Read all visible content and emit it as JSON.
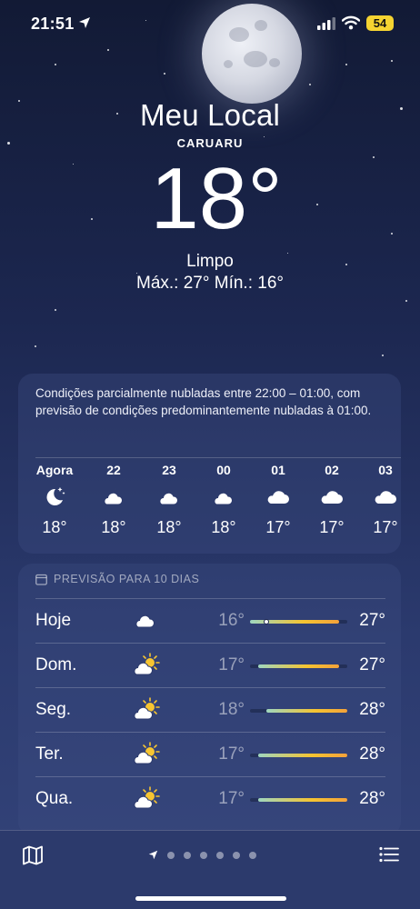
{
  "status_bar": {
    "time": "21:51",
    "battery": "54",
    "icons": [
      "location-arrow-icon",
      "cellular-signal-icon",
      "wifi-icon",
      "battery-icon"
    ]
  },
  "header": {
    "title": "Meu Local",
    "city": "CARUARU",
    "temperature": "18°",
    "condition": "Limpo",
    "hi_lo": "Máx.: 27°  Mín.: 16°"
  },
  "hourly": {
    "summary": "Condições parcialmente nubladas entre 22:00 – 01:00, com previsão de condições predominantemente nubladas à 01:00.",
    "items": [
      {
        "hour": "Agora",
        "icon": "moon-stars-icon",
        "temp": "18°"
      },
      {
        "hour": "22",
        "icon": "cloud-moon-icon",
        "temp": "18°"
      },
      {
        "hour": "23",
        "icon": "cloud-moon-icon",
        "temp": "18°"
      },
      {
        "hour": "00",
        "icon": "cloud-moon-icon",
        "temp": "18°"
      },
      {
        "hour": "01",
        "icon": "cloud-icon",
        "temp": "17°"
      },
      {
        "hour": "02",
        "icon": "cloud-icon",
        "temp": "17°"
      },
      {
        "hour": "03",
        "icon": "cloud-icon",
        "temp": "17°"
      }
    ]
  },
  "daily": {
    "title": "PREVISÃO PARA 10 DIAS",
    "range_min": 16,
    "range_max": 28,
    "current_temp": 18,
    "items": [
      {
        "day": "Hoje",
        "icon": "cloud-moon-icon",
        "low": "16°",
        "high": "27°",
        "low_value": 16,
        "high_value": 27
      },
      {
        "day": "Dom.",
        "icon": "cloud-sun-icon",
        "low": "17°",
        "high": "27°",
        "low_value": 17,
        "high_value": 27
      },
      {
        "day": "Seg.",
        "icon": "cloud-sun-icon",
        "low": "18°",
        "high": "28°",
        "low_value": 18,
        "high_value": 28
      },
      {
        "day": "Ter.",
        "icon": "cloud-sun-icon",
        "low": "17°",
        "high": "28°",
        "low_value": 17,
        "high_value": 28
      },
      {
        "day": "Qua.",
        "icon": "cloud-sun-icon",
        "low": "17°",
        "high": "28°",
        "low_value": 17,
        "high_value": 28
      }
    ]
  },
  "bottom_bar": {
    "left_icon": "map-icon",
    "right_icon": "list-icon",
    "page_count": 7,
    "current_page_icon": "location-arrow-icon"
  },
  "colors": {
    "background_top": "#121a35",
    "background_bottom": "#34447a",
    "bar_cool": "#9fd7c0",
    "bar_warm": "#f5c431",
    "bar_hot": "#f4a23a",
    "battery": "#f5d331"
  }
}
